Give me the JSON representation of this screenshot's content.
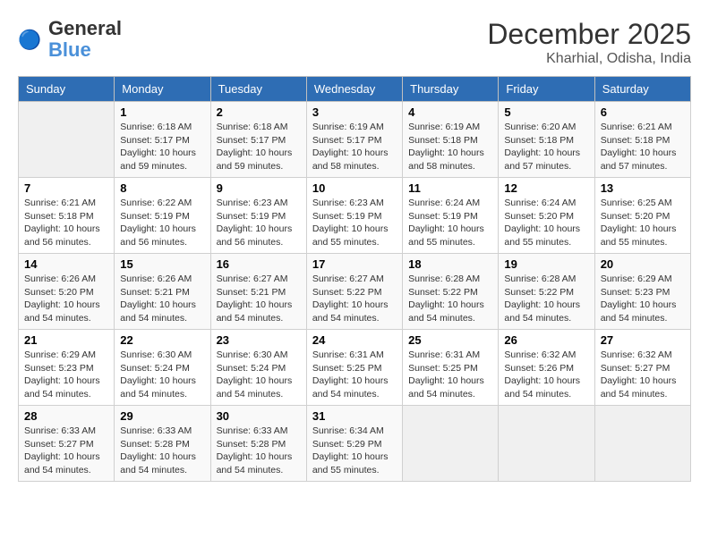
{
  "logo": {
    "text_general": "General",
    "text_blue": "Blue"
  },
  "title": {
    "month_year": "December 2025",
    "location": "Kharhial, Odisha, India"
  },
  "weekdays": [
    "Sunday",
    "Monday",
    "Tuesday",
    "Wednesday",
    "Thursday",
    "Friday",
    "Saturday"
  ],
  "weeks": [
    [
      {
        "day": "",
        "empty": true
      },
      {
        "day": "1",
        "sunrise": "6:18 AM",
        "sunset": "5:17 PM",
        "daylight": "10 hours and 59 minutes."
      },
      {
        "day": "2",
        "sunrise": "6:18 AM",
        "sunset": "5:17 PM",
        "daylight": "10 hours and 59 minutes."
      },
      {
        "day": "3",
        "sunrise": "6:19 AM",
        "sunset": "5:17 PM",
        "daylight": "10 hours and 58 minutes."
      },
      {
        "day": "4",
        "sunrise": "6:19 AM",
        "sunset": "5:18 PM",
        "daylight": "10 hours and 58 minutes."
      },
      {
        "day": "5",
        "sunrise": "6:20 AM",
        "sunset": "5:18 PM",
        "daylight": "10 hours and 57 minutes."
      },
      {
        "day": "6",
        "sunrise": "6:21 AM",
        "sunset": "5:18 PM",
        "daylight": "10 hours and 57 minutes."
      }
    ],
    [
      {
        "day": "7",
        "sunrise": "6:21 AM",
        "sunset": "5:18 PM",
        "daylight": "10 hours and 56 minutes."
      },
      {
        "day": "8",
        "sunrise": "6:22 AM",
        "sunset": "5:19 PM",
        "daylight": "10 hours and 56 minutes."
      },
      {
        "day": "9",
        "sunrise": "6:23 AM",
        "sunset": "5:19 PM",
        "daylight": "10 hours and 56 minutes."
      },
      {
        "day": "10",
        "sunrise": "6:23 AM",
        "sunset": "5:19 PM",
        "daylight": "10 hours and 55 minutes."
      },
      {
        "day": "11",
        "sunrise": "6:24 AM",
        "sunset": "5:19 PM",
        "daylight": "10 hours and 55 minutes."
      },
      {
        "day": "12",
        "sunrise": "6:24 AM",
        "sunset": "5:20 PM",
        "daylight": "10 hours and 55 minutes."
      },
      {
        "day": "13",
        "sunrise": "6:25 AM",
        "sunset": "5:20 PM",
        "daylight": "10 hours and 55 minutes."
      }
    ],
    [
      {
        "day": "14",
        "sunrise": "6:26 AM",
        "sunset": "5:20 PM",
        "daylight": "10 hours and 54 minutes."
      },
      {
        "day": "15",
        "sunrise": "6:26 AM",
        "sunset": "5:21 PM",
        "daylight": "10 hours and 54 minutes."
      },
      {
        "day": "16",
        "sunrise": "6:27 AM",
        "sunset": "5:21 PM",
        "daylight": "10 hours and 54 minutes."
      },
      {
        "day": "17",
        "sunrise": "6:27 AM",
        "sunset": "5:22 PM",
        "daylight": "10 hours and 54 minutes."
      },
      {
        "day": "18",
        "sunrise": "6:28 AM",
        "sunset": "5:22 PM",
        "daylight": "10 hours and 54 minutes."
      },
      {
        "day": "19",
        "sunrise": "6:28 AM",
        "sunset": "5:22 PM",
        "daylight": "10 hours and 54 minutes."
      },
      {
        "day": "20",
        "sunrise": "6:29 AM",
        "sunset": "5:23 PM",
        "daylight": "10 hours and 54 minutes."
      }
    ],
    [
      {
        "day": "21",
        "sunrise": "6:29 AM",
        "sunset": "5:23 PM",
        "daylight": "10 hours and 54 minutes."
      },
      {
        "day": "22",
        "sunrise": "6:30 AM",
        "sunset": "5:24 PM",
        "daylight": "10 hours and 54 minutes."
      },
      {
        "day": "23",
        "sunrise": "6:30 AM",
        "sunset": "5:24 PM",
        "daylight": "10 hours and 54 minutes."
      },
      {
        "day": "24",
        "sunrise": "6:31 AM",
        "sunset": "5:25 PM",
        "daylight": "10 hours and 54 minutes."
      },
      {
        "day": "25",
        "sunrise": "6:31 AM",
        "sunset": "5:25 PM",
        "daylight": "10 hours and 54 minutes."
      },
      {
        "day": "26",
        "sunrise": "6:32 AM",
        "sunset": "5:26 PM",
        "daylight": "10 hours and 54 minutes."
      },
      {
        "day": "27",
        "sunrise": "6:32 AM",
        "sunset": "5:27 PM",
        "daylight": "10 hours and 54 minutes."
      }
    ],
    [
      {
        "day": "28",
        "sunrise": "6:33 AM",
        "sunset": "5:27 PM",
        "daylight": "10 hours and 54 minutes."
      },
      {
        "day": "29",
        "sunrise": "6:33 AM",
        "sunset": "5:28 PM",
        "daylight": "10 hours and 54 minutes."
      },
      {
        "day": "30",
        "sunrise": "6:33 AM",
        "sunset": "5:28 PM",
        "daylight": "10 hours and 54 minutes."
      },
      {
        "day": "31",
        "sunrise": "6:34 AM",
        "sunset": "5:29 PM",
        "daylight": "10 hours and 55 minutes."
      },
      {
        "day": "",
        "empty": true
      },
      {
        "day": "",
        "empty": true
      },
      {
        "day": "",
        "empty": true
      }
    ]
  ]
}
